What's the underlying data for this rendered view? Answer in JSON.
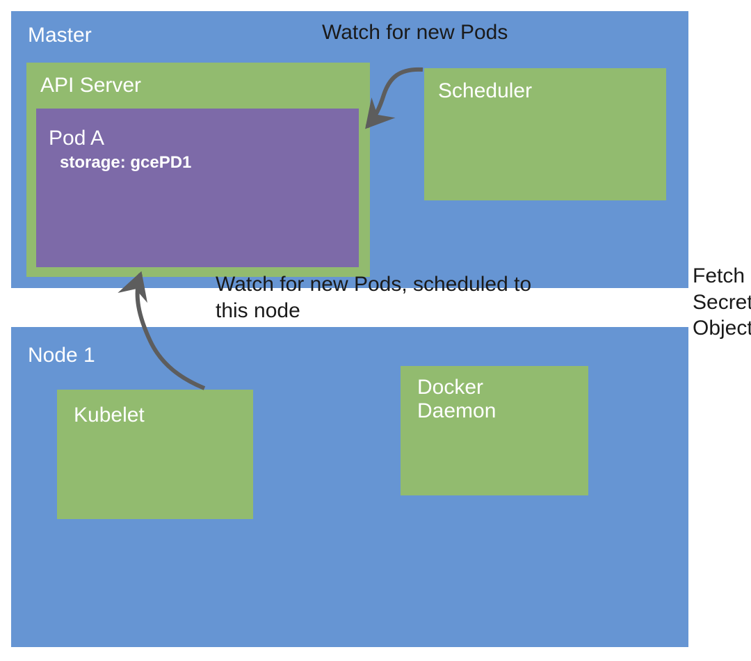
{
  "colors": {
    "blue": "#6695d3",
    "green": "#92bb6f",
    "purple": "#7d6aa8",
    "arrow": "#5d5d5d",
    "textWhite": "#ffffff",
    "textBlack": "#1a1a1a"
  },
  "master": {
    "title": "Master",
    "apiServer": {
      "title": "API Server",
      "pod": {
        "title": "Pod A",
        "storageLabel": "storage: gcePD1"
      }
    },
    "scheduler": {
      "title": "Scheduler"
    }
  },
  "node1": {
    "title": "Node 1",
    "kubelet": {
      "title": "Kubelet"
    },
    "docker": {
      "title": "Docker\nDaemon"
    }
  },
  "annotations": {
    "watchNewPods": "Watch for new Pods",
    "watchScheduled": "Watch for new Pods, scheduled to this node",
    "fetchSecret": "Fetch\nSecret\nObject"
  }
}
